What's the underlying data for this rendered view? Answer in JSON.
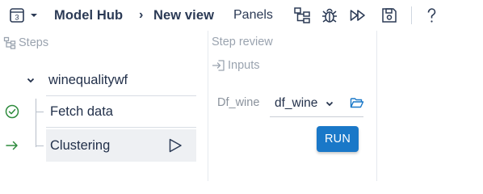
{
  "colors": {
    "text_dark": "#2b3a55",
    "muted": "#9aa3af",
    "accent": "#1a78c8",
    "success": "#2e8b3d"
  },
  "toolbar": {
    "workflow_badge": "3",
    "breadcrumb": [
      "Model Hub",
      "New view"
    ],
    "panels_label": "Panels",
    "icons": [
      "tree-layout-icon",
      "bug-icon",
      "fast-forward-icon",
      "save-icon",
      "help-icon"
    ]
  },
  "steps_panel": {
    "header": "Steps",
    "workflow_name": "winequalitywf",
    "steps": [
      {
        "label": "Fetch data",
        "status": "completed"
      },
      {
        "label": "Clustering",
        "status": "current"
      }
    ]
  },
  "review_panel": {
    "title": "Step review",
    "inputs_header": "Inputs",
    "inputs": [
      {
        "label": "Df_wine",
        "value": "df_wine"
      }
    ],
    "run_label": "RUN"
  }
}
